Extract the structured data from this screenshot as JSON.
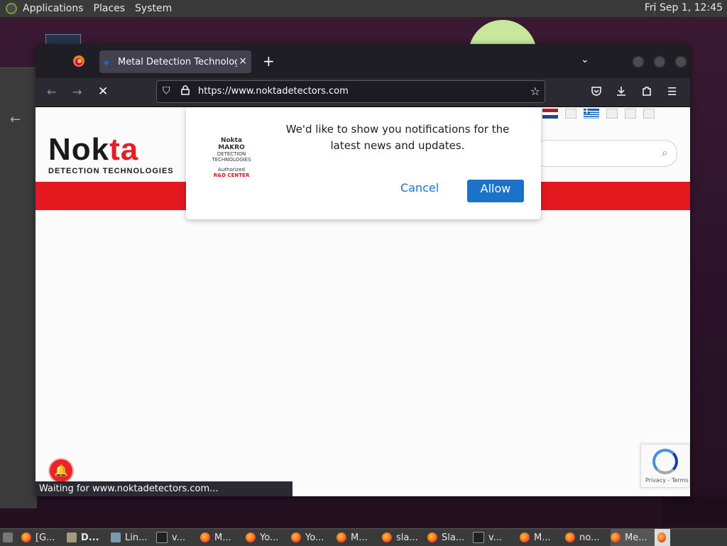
{
  "top_panel": {
    "menus": [
      "Applications",
      "Places",
      "System"
    ],
    "clock": "Fri Sep 1, 12:45"
  },
  "browser": {
    "tab_title": "Metal Detection Technologie",
    "tab_close": "×",
    "new_tab": "+",
    "url": "https://www.noktadetectors.com",
    "status": "Waiting for www.noktadetectors.com..."
  },
  "page": {
    "logo_main_a": "Nok",
    "logo_main_b": "ta",
    "logo_sub": "DETECTION TECHNOLOGIES",
    "recaptcha_terms": "Privacy - Terms"
  },
  "popup": {
    "logo_line1": "Nokta MAKRO",
    "logo_line2": "DETECTION TECHNOLOGIES",
    "logo_line3": "Authorized",
    "logo_line4": "R&D CENTER",
    "message": "We'd like to show you notifications for the latest news and updates.",
    "cancel": "Cancel",
    "allow": "Allow"
  },
  "taskbar": {
    "items": [
      {
        "label": "[G...",
        "icon": "firefox-icon"
      },
      {
        "label": "D...",
        "icon": "folder-icon"
      },
      {
        "label": "Lin...",
        "icon": "tool-icon"
      },
      {
        "label": "v...",
        "icon": "terminal-icon"
      },
      {
        "label": "M...",
        "icon": "firefox-icon"
      },
      {
        "label": "Yo...",
        "icon": "firefox-icon"
      },
      {
        "label": "Yo...",
        "icon": "firefox-icon"
      },
      {
        "label": "M...",
        "icon": "firefox-icon"
      },
      {
        "label": "sla...",
        "icon": "firefox-icon"
      },
      {
        "label": "Sla...",
        "icon": "firefox-icon"
      },
      {
        "label": "v...",
        "icon": "terminal-icon"
      },
      {
        "label": "M...",
        "icon": "firefox-icon"
      },
      {
        "label": "no...",
        "icon": "firefox-icon"
      },
      {
        "label": "Me...",
        "icon": "firefox-icon"
      }
    ]
  },
  "colors": {
    "brand_red": "#e3191f",
    "allow_blue": "#1b73c9"
  }
}
